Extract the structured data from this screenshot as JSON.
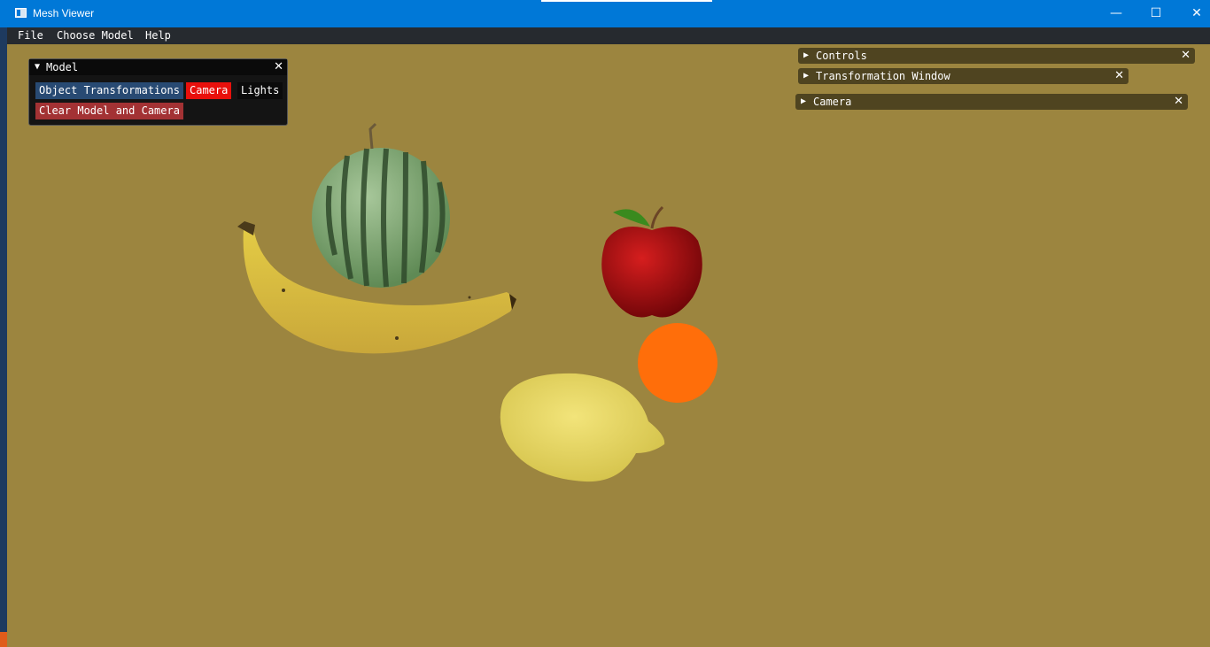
{
  "window": {
    "title": "Mesh Viewer",
    "controls": {
      "minimize": "—",
      "maximize": "☐",
      "close": "✕"
    }
  },
  "menu": {
    "file": "File",
    "choose_model": "Choose Model",
    "help": "Help"
  },
  "model_panel": {
    "title": "Model",
    "buttons": {
      "object_transformations": "Object Transformations",
      "camera": "Camera",
      "lights": "Lights",
      "clear": "Clear Model and Camera"
    },
    "close": "✕"
  },
  "collapsed_windows": {
    "controls": "Controls",
    "transformation_window": "Transformation Window",
    "camera": "Camera"
  },
  "scene": {
    "background": "#9c853f",
    "objects": [
      "watermelon",
      "banana",
      "apple",
      "orange",
      "lemon"
    ]
  }
}
